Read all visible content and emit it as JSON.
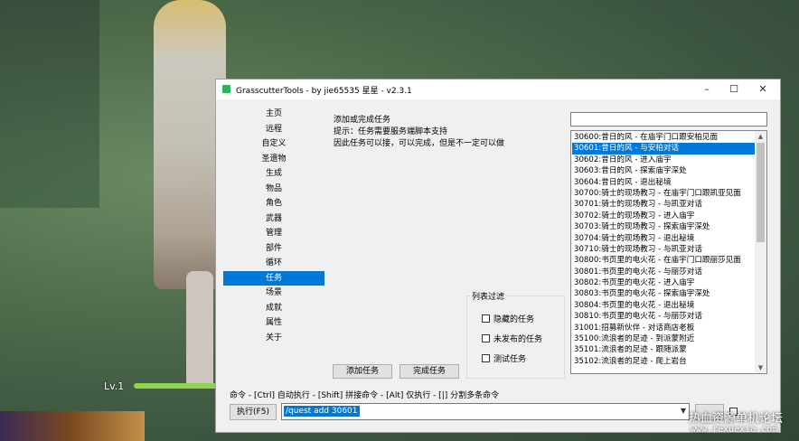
{
  "window": {
    "title": "GrasscutterTools  - by jie65535 星星  - v2.3.1",
    "min": "–",
    "max": "☐",
    "close": "✕"
  },
  "nav": [
    {
      "label": "主页"
    },
    {
      "label": "远程"
    },
    {
      "label": "自定义"
    },
    {
      "label": "圣遗物"
    },
    {
      "label": "生成"
    },
    {
      "label": "物品"
    },
    {
      "label": "角色"
    },
    {
      "label": "武器"
    },
    {
      "label": "管理"
    },
    {
      "label": "部件"
    },
    {
      "label": "循环"
    },
    {
      "label": "任务",
      "selected": true
    },
    {
      "label": "场景"
    },
    {
      "label": "成就"
    },
    {
      "label": "属性"
    },
    {
      "label": "关于"
    }
  ],
  "panel": {
    "title": "添加或完成任务",
    "hint1": "提示：任务需要服务端脚本支持",
    "hint2": "因此任务可以接，可以完成，但是不一定可以做"
  },
  "filter": {
    "label": "列表过滤",
    "options": [
      "隐藏的任务",
      "未发布的任务",
      "测试任务"
    ]
  },
  "buttons": {
    "add": "添加任务",
    "complete": "完成任务",
    "execute": "执行(F5)"
  },
  "search": {
    "value": ""
  },
  "quests": [
    "30600:昔日的风 - 在庙宇门口跟安柏见面",
    "30601:昔日的风 - 与安柏对话",
    "30602:昔日的风 - 进入庙宇",
    "30603:昔日的风 - 探索庙宇深处",
    "30604:昔日的风 - 退出秘境",
    "30700:骑士的现场教习 - 在庙宇门口跟凯亚见面",
    "30701:骑士的现场教习 - 与凯亚对话",
    "30702:骑士的现场教习 - 进入庙宇",
    "30703:骑士的现场教习 - 探索庙宇深处",
    "30704:骑士的现场教习 - 退出秘境",
    "30710:骑士的现场教习 - 与凯亚对话",
    "30800:书页里的电火花 - 在庙宇门口跟丽莎见面",
    "30801:书页里的电火花 - 与丽莎对话",
    "30802:书页里的电火花 - 进入庙宇",
    "30803:书页里的电火花 - 探索庙宇深处",
    "30804:书页里的电火花 - 退出秘境",
    "30810:书页里的电火花 - 与丽莎对话",
    "31001:招募新伙伴 - 对话商店老板",
    "35100:流浪者的足迹 - 到派蒙附近",
    "35101:流浪者的足迹 - 跟随派蒙",
    "35102:流浪者的足迹 - 爬上岩台"
  ],
  "selected_quest_index": 1,
  "command": {
    "hint": "命令 - [Ctrl] 自动执行 - [Shift] 拼接命令 - [Alt] 仅执行 - [|] 分割多条命令",
    "value": "/quest add 30601"
  },
  "hud": {
    "level": "Lv.1"
  },
  "watermark": {
    "line1": "热血资源单机论坛",
    "line2": "www.rexuexia.com"
  }
}
